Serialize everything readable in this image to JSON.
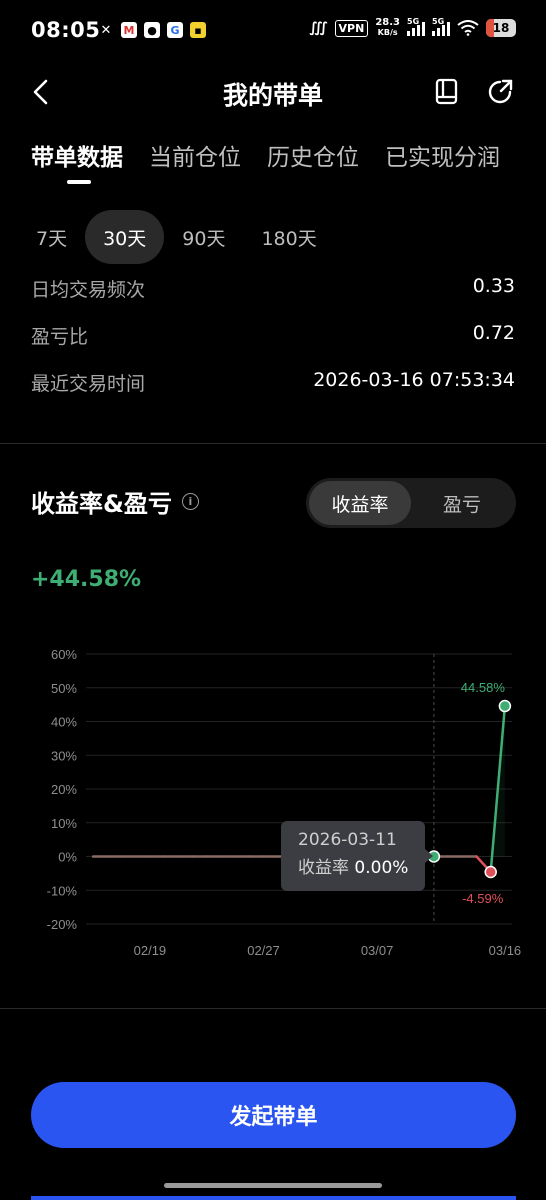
{
  "status_bar": {
    "time": "08:05",
    "vpn": "VPN",
    "speed_value": "28.3",
    "speed_unit": "KB/s",
    "net_1": "5G",
    "net_2": "5G",
    "battery": "18",
    "app_icons": [
      "x-icon",
      "gmail-icon",
      "qq-icon",
      "browser-icon",
      "app-icon"
    ]
  },
  "header": {
    "title": "我的带单"
  },
  "tabs": [
    "带单数据",
    "当前仓位",
    "历史仓位",
    "已实现分润"
  ],
  "periods": [
    "7天",
    "30天",
    "90天",
    "180天"
  ],
  "stats": [
    {
      "label": "日均交易频次",
      "value": "0.33"
    },
    {
      "label": "盈亏比",
      "value": "0.72"
    },
    {
      "label": "最近交易时间",
      "value": "2026-03-16 07:53:34"
    }
  ],
  "section": {
    "title": "收益率&盈亏",
    "info_icon": "i",
    "toggle": [
      "收益率",
      "盈亏"
    ],
    "headline_value": "+44.58%"
  },
  "tooltip": {
    "date": "2026-03-11",
    "label": "收益率",
    "value": "0.00%"
  },
  "chart_data": {
    "type": "line",
    "y_ticks": [
      "60%",
      "50%",
      "40%",
      "30%",
      "20%",
      "10%",
      "0%",
      "-10%",
      "-20%"
    ],
    "ylim": [
      -20,
      60
    ],
    "x_ticks": [
      "02/19",
      "02/27",
      "03/07",
      "03/16"
    ],
    "x": [
      "02/15",
      "02/16",
      "02/17",
      "02/18",
      "02/19",
      "02/20",
      "02/21",
      "02/22",
      "02/23",
      "02/24",
      "02/25",
      "02/26",
      "02/27",
      "02/28",
      "03/01",
      "03/02",
      "03/03",
      "03/04",
      "03/05",
      "03/06",
      "03/07",
      "03/08",
      "03/09",
      "03/10",
      "03/11",
      "03/12",
      "03/13",
      "03/14",
      "03/15",
      "03/16"
    ],
    "values": [
      0,
      0,
      0,
      0,
      0,
      0,
      0,
      0,
      0,
      0,
      0,
      0,
      0,
      0,
      0,
      0,
      0,
      0,
      0,
      0,
      0,
      0,
      0,
      0,
      0,
      0,
      0,
      0,
      -4.59,
      44.58
    ],
    "annotations": [
      {
        "x": "03/16",
        "y": 44.58,
        "text": "44.58%"
      },
      {
        "x": "03/15",
        "y": -4.59,
        "text": "-4.59%"
      }
    ],
    "highlight_x": "03/11",
    "colors": {
      "positive": "#3fae74",
      "negative": "#e0505a",
      "zero_line": "#8a6a63",
      "grid": "#222222"
    },
    "grid": true
  },
  "cta": {
    "label": "发起带单"
  }
}
